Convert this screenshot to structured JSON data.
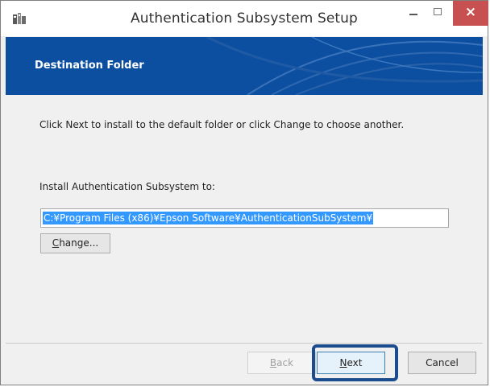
{
  "window": {
    "title": "Authentication Subsystem Setup",
    "minimize_icon": "minimize-icon",
    "maximize_icon": "maximize-icon",
    "close_glyph": "×"
  },
  "banner": {
    "title": "Destination Folder",
    "color": "#0c4fa0"
  },
  "body": {
    "instruction": "Click Next to install to the default folder or click Change to choose another.",
    "install_label": "Install Authentication Subsystem to:",
    "install_path": "C:¥Program Files (x86)¥Epson Software¥AuthenticationSubSystem¥",
    "change_button": {
      "accel": "C",
      "rest": "hange..."
    }
  },
  "footer": {
    "back_button": {
      "accel": "B",
      "rest": "ack",
      "enabled": false
    },
    "next_button": {
      "accel": "N",
      "rest": "ext",
      "enabled": true
    },
    "cancel_button": {
      "label": "Cancel",
      "enabled": true
    },
    "highlight_color": "#1a4c8e"
  }
}
